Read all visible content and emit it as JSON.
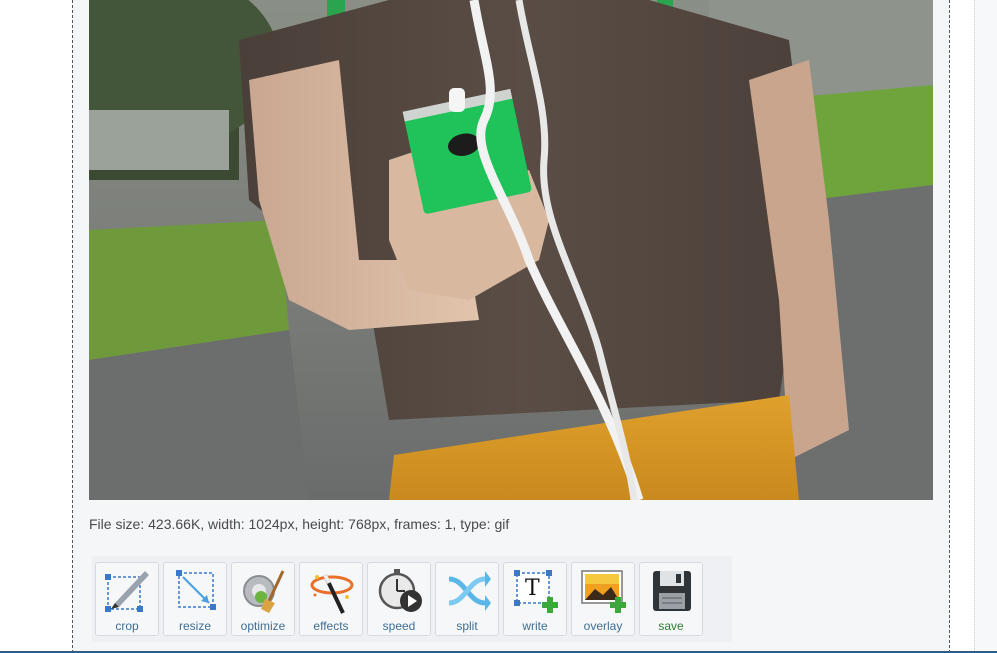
{
  "file_info": "File size: 423.66K, width: 1024px, height: 768px, frames: 1, type: gif",
  "toolbar": {
    "tools": [
      {
        "label": "crop",
        "icon": "crop-icon"
      },
      {
        "label": "resize",
        "icon": "resize-icon"
      },
      {
        "label": "optimize",
        "icon": "optimize-icon"
      },
      {
        "label": "effects",
        "icon": "effects-icon"
      },
      {
        "label": "speed",
        "icon": "speed-icon"
      },
      {
        "label": "split",
        "icon": "split-icon"
      },
      {
        "label": "write",
        "icon": "write-icon"
      },
      {
        "label": "overlay",
        "icon": "overlay-icon"
      },
      {
        "label": "save",
        "icon": "save-icon"
      }
    ]
  },
  "colors": {
    "panel_bg": "#f5f6f8",
    "label_blue": "#3f6f94",
    "save_green": "#2f7d32",
    "phone_green": "#1fc35a"
  }
}
